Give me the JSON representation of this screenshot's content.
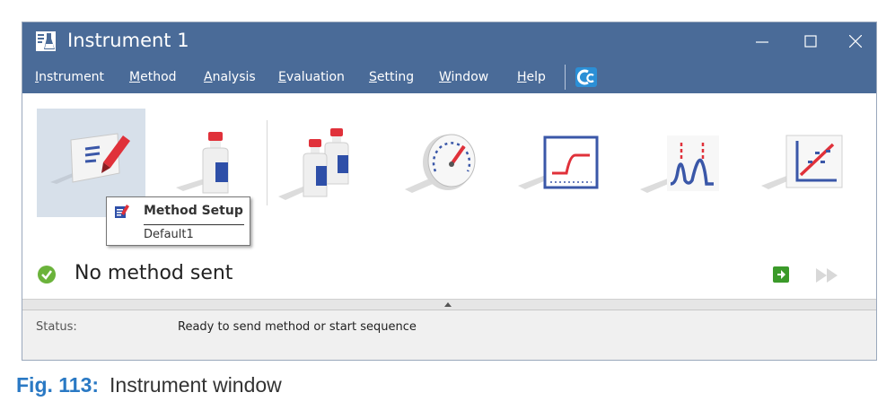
{
  "window": {
    "title": "Instrument 1",
    "icon": "flask-icon",
    "controls": [
      "minimize-icon",
      "maximize-icon",
      "close-icon"
    ]
  },
  "menu": {
    "items": [
      {
        "underline": "I",
        "rest": "nstrument"
      },
      {
        "underline": "M",
        "rest": "ethod"
      },
      {
        "underline": "A",
        "rest": "nalysis"
      },
      {
        "underline": "E",
        "rest": "valuation"
      },
      {
        "underline": "S",
        "rest": "etting"
      },
      {
        "underline": "W",
        "rest": "indow"
      },
      {
        "underline": "H",
        "rest": "elp"
      }
    ],
    "logo_icon": "clarity-logo-icon"
  },
  "toolbar": {
    "tiles": [
      {
        "icon": "method-setup-icon",
        "selected": true
      },
      {
        "icon": "single-vial-icon"
      },
      {
        "icon": "sequence-vials-icon"
      },
      {
        "icon": "device-monitor-gauge-icon"
      },
      {
        "icon": "single-analysis-icon"
      },
      {
        "icon": "data-acquisition-icon"
      },
      {
        "icon": "calibration-icon"
      }
    ]
  },
  "tooltip": {
    "title": "Method Setup",
    "subtitle": "Default1",
    "icon": "method-setup-icon"
  },
  "status_panel": {
    "text": "No method sent",
    "icon": "check-circle-icon",
    "send_icon": "send-method-icon",
    "run_icon": "fast-forward-icon"
  },
  "statusbar": {
    "label": "Status:",
    "value": "Ready to send method or start sequence"
  },
  "caption": {
    "label": "Fig. 113:",
    "text": "Instrument window"
  },
  "colors": {
    "titlebar": "#4a6b98",
    "accent_blue": "#2a79c4",
    "status_green": "#6bb33b",
    "icon_red": "#e0313a",
    "icon_blue": "#2e4fa8"
  }
}
